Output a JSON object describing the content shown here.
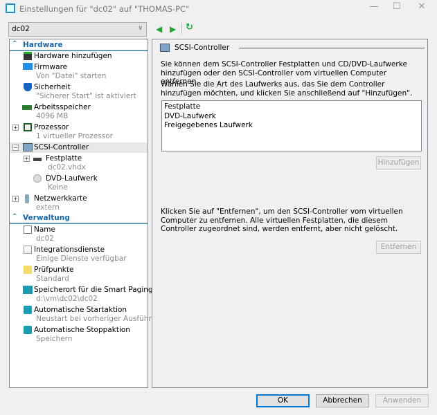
{
  "window": {
    "title": "Einstellungen für \"dc02\" auf \"THOMAS-PC\""
  },
  "vm_selector": {
    "value": "dc02"
  },
  "tree": {
    "hardware_header": "Hardware",
    "items": [
      {
        "label": "Hardware hinzufügen"
      },
      {
        "label": "Firmware",
        "sub": "Von \"Datei\" starten"
      },
      {
        "label": "Sicherheit",
        "sub": "\"Sicherer Start\" ist aktiviert"
      },
      {
        "label": "Arbeitsspeicher",
        "sub": "4096 MB"
      },
      {
        "label": "Prozessor",
        "sub": "1 virtueller Prozessor"
      },
      {
        "label": "SCSI-Controller"
      },
      {
        "label": "Festplatte",
        "sub": "dc02.vhdx"
      },
      {
        "label": "DVD-Laufwerk",
        "sub": "Keine"
      },
      {
        "label": "Netzwerkkarte",
        "sub": "extern"
      }
    ],
    "management_header": "Verwaltung",
    "mgmt_items": [
      {
        "label": "Name",
        "sub": "dc02"
      },
      {
        "label": "Integrationsdienste",
        "sub": "Einige Dienste verfügbar"
      },
      {
        "label": "Prüfpunkte",
        "sub": "Standard"
      },
      {
        "label": "Speicherort für die Smart Paging-D...",
        "sub": "d:\\vm\\dc02\\dc02"
      },
      {
        "label": "Automatische Startaktion",
        "sub": "Neustart bei vorheriger Ausführung"
      },
      {
        "label": "Automatische Stoppaktion",
        "sub": "Speichern"
      }
    ]
  },
  "panel": {
    "title": "SCSI-Controller",
    "intro": "Sie können dem SCSI-Controller Festplatten und CD/DVD-Laufwerke hinzufügen oder den SCSI-Controller vom virtuellen Computer entfernen.",
    "instruction": "Wählen Sie die Art des Laufwerks aus, das Sie dem Controller hinzufügen möchten, und klicken Sie anschließend auf \"Hinzufügen\".",
    "drive_types": [
      "Festplatte",
      "DVD-Laufwerk",
      "Freigegebenes Laufwerk"
    ],
    "add_button": "Hinzufügen",
    "remove_text": "Klicken Sie auf \"Entfernen\", um den SCSI-Controller vom virtuellen Computer zu entfernen. Alle virtuellen Festplatten, die diesem Controller zugeordnet sind, werden entfernt, aber nicht gelöscht.",
    "remove_button": "Entfernen"
  },
  "footer": {
    "ok": "OK",
    "cancel": "Abbrechen",
    "apply": "Anwenden"
  }
}
